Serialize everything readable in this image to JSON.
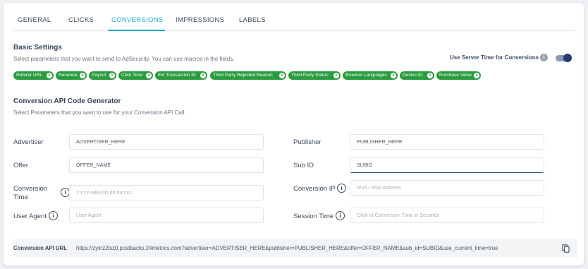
{
  "tabs": [
    {
      "label": "GENERAL",
      "active": false
    },
    {
      "label": "CLICKS",
      "active": false
    },
    {
      "label": "CONVERSIONS",
      "active": true
    },
    {
      "label": "IMPRESSIONS",
      "active": false
    },
    {
      "label": "LABELS",
      "active": false
    }
  ],
  "basic_settings": {
    "title": "Basic Settings",
    "description": "Select parameters that you want to send to AdSecurity. You can use macros in the fields.",
    "server_time_label": "Use Server Time for Conversions",
    "server_time_enabled": true,
    "tags": [
      "Referer URL",
      "Revenue",
      "Payout",
      "Click Time",
      "Ext Transaction ID",
      "Third Party Rejected Reason",
      "Third Party Status",
      "Browser Languages",
      "Device ID",
      "Purchase Value"
    ]
  },
  "api_generator": {
    "title": "Conversion API Code Generator",
    "description": "Select Parameters that you want to use for your Conversion API Call.",
    "fields": {
      "advertiser": {
        "label": "Advertiser",
        "value": "ADVERTISER_HERE",
        "placeholder": ""
      },
      "publisher": {
        "label": "Publisher",
        "value": "PUBLISHER_HERE",
        "placeholder": ""
      },
      "offer": {
        "label": "Offer",
        "value": "OFFER_NAME",
        "placeholder": ""
      },
      "sub_id": {
        "label": "Sub ID",
        "value": "SUBID",
        "placeholder": ""
      },
      "conversion_time": {
        "label_line1": "Conversion",
        "label_line2": "Time",
        "value": "",
        "placeholder": "YYYY-MM-DD hh:mm:ss"
      },
      "conversion_ip": {
        "label": "Conversion IP",
        "value": "",
        "placeholder": "IPv4 / IPv6 Address"
      },
      "user_agent": {
        "label": "User Agent",
        "value": "",
        "placeholder": "User Agent"
      },
      "session_time": {
        "label": "Session Time",
        "value": "",
        "placeholder": "Click to Conversion Time in Seconds"
      }
    },
    "url_label": "Conversion API URL",
    "url_value": "https://zyinz2lsz0.postbacks.24metrics.com?advertiser=ADVERTISER_HERE&publisher=PUBLISHER_HERE&offer=OFFER_NAME&sub_id=SUBID&use_current_time=true"
  },
  "colors": {
    "accent": "#1ba9d6",
    "tag_green": "#2a9c3f",
    "toggle_on": "#243d6b"
  }
}
